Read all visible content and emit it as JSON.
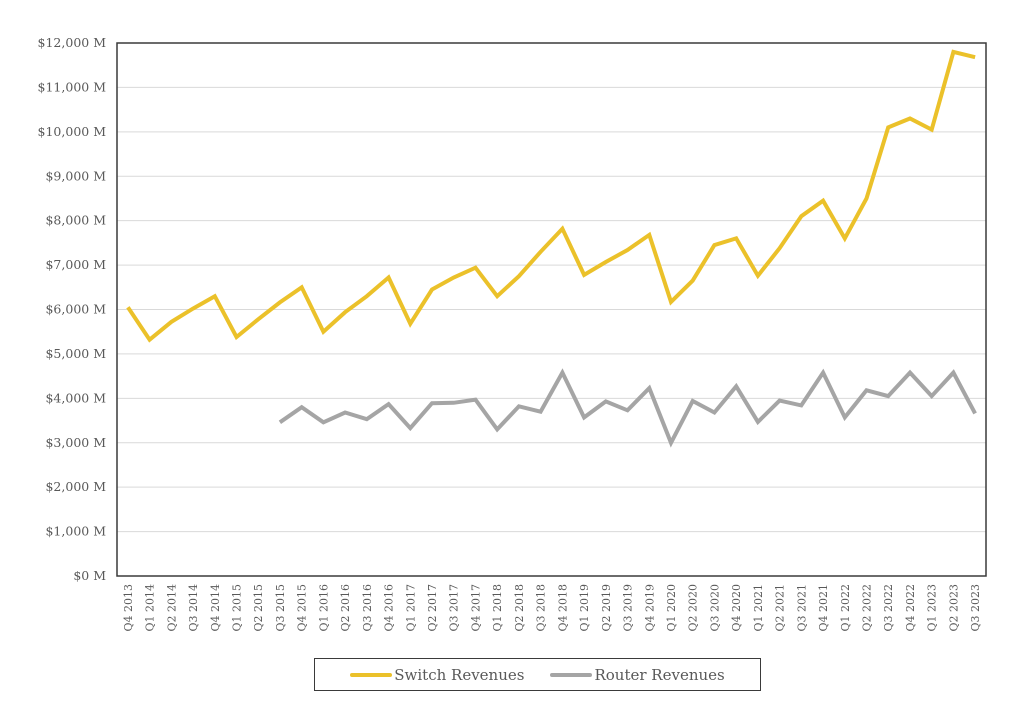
{
  "chart_data": {
    "type": "line",
    "title": "",
    "xlabel": "",
    "ylabel": "",
    "ylim": [
      0,
      12000
    ],
    "yticks": [
      0,
      1000,
      2000,
      3000,
      4000,
      5000,
      6000,
      7000,
      8000,
      9000,
      10000,
      11000,
      12000
    ],
    "ytick_labels": [
      "$0 M",
      "$1,000 M",
      "$2,000 M",
      "$3,000 M",
      "$4,000 M",
      "$5,000 M",
      "$6,000 M",
      "$7,000 M",
      "$8,000 M",
      "$9,000 M",
      "$10,000 M",
      "$11,000 M",
      "$12,000 M"
    ],
    "grid": "horizontal",
    "legend_position": "bottom",
    "categories": [
      "Q4 2013",
      "Q1 2014",
      "Q2 2014",
      "Q3 2014",
      "Q4 2014",
      "Q1 2015",
      "Q2 2015",
      "Q3 2015",
      "Q4 2015",
      "Q1 2016",
      "Q2 2016",
      "Q3 2016",
      "Q4 2016",
      "Q1 2017",
      "Q2 2017",
      "Q3 2017",
      "Q4 2017",
      "Q1 2018",
      "Q2 2018",
      "Q3 2018",
      "Q4 2018",
      "Q1 2019",
      "Q2 2019",
      "Q3 2019",
      "Q4 2019",
      "Q1 2020",
      "Q2 2020",
      "Q3 2020",
      "Q4 2020",
      "Q1 2021",
      "Q2 2021",
      "Q3 2021",
      "Q4 2021",
      "Q1 2022",
      "Q2 2022",
      "Q3 2022",
      "Q4 2022",
      "Q1 2023",
      "Q2 2023",
      "Q3 2023"
    ],
    "series": [
      {
        "name": "Switch Revenues",
        "color": "#EBC12A",
        "values": [
          6050,
          5320,
          5720,
          6020,
          6300,
          5380,
          5780,
          6160,
          6500,
          5500,
          5940,
          6300,
          6720,
          5680,
          6450,
          6720,
          6940,
          6300,
          6750,
          7300,
          7820,
          6780,
          7070,
          7340,
          7680,
          6170,
          6650,
          7450,
          7600,
          6760,
          7380,
          8100,
          8450,
          7600,
          8500,
          10100,
          10300,
          10050,
          11800,
          11680
        ]
      },
      {
        "name": "Router Revenues",
        "color": "#A5A5A5",
        "values": [
          null,
          null,
          null,
          null,
          null,
          null,
          null,
          3460,
          3800,
          3460,
          3680,
          3530,
          3870,
          3330,
          3890,
          3900,
          3970,
          3300,
          3820,
          3700,
          4580,
          3570,
          3930,
          3730,
          4230,
          3000,
          3940,
          3680,
          4270,
          3470,
          3950,
          3840,
          4580,
          3570,
          4180,
          4050,
          4580,
          4050,
          4580,
          3660
        ]
      }
    ]
  }
}
